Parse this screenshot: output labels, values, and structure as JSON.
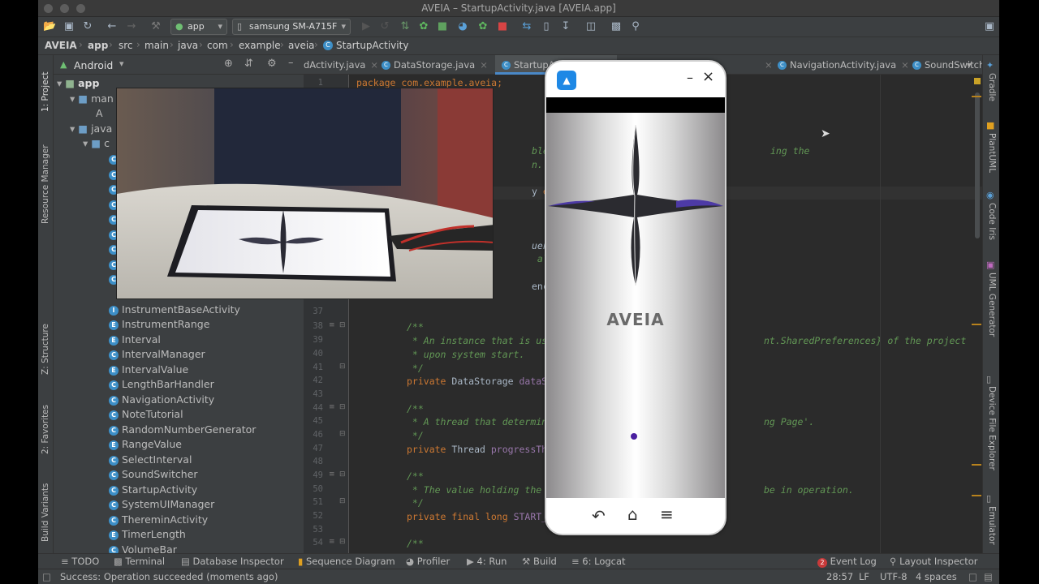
{
  "window": {
    "title": "AVEIA – StartupActivity.java [AVEIA.app]"
  },
  "toolbar": {
    "module_combo": "app",
    "device_combo": "samsung SM-A715F"
  },
  "breadcrumb": [
    "AVEIA",
    "app",
    "src",
    "main",
    "java",
    "com",
    "example",
    "aveia",
    "StartupActivity"
  ],
  "project_panel": {
    "view_mode": "Android",
    "tree_top": [
      {
        "label": "app"
      },
      {
        "label": "man"
      },
      {
        "label": "A"
      },
      {
        "label": "java"
      },
      {
        "label": "c"
      }
    ],
    "classes": [
      "InstrumentBaseActivity",
      "InstrumentRange",
      "Interval",
      "IntervalManager",
      "IntervalValue",
      "LengthBarHandler",
      "NavigationActivity",
      "NoteTutorial",
      "RandomNumberGenerator",
      "RangeValue",
      "SelectInterval",
      "SoundSwitcher",
      "StartupActivity",
      "SystemUIManager",
      "ThereminActivity",
      "TimerLength",
      "VolumeBar"
    ]
  },
  "left_tool_tabs": [
    "1: Project",
    "Resource Manager",
    "Z: Structure",
    "2: Favorites",
    "Build Variants"
  ],
  "right_tool_tabs": [
    "Gradle",
    "PlantUML",
    "Code Iris",
    "UML Generator",
    "Device File Explorer",
    "Emulator"
  ],
  "editor_tabs": [
    {
      "label": "dActivity.java",
      "active": false
    },
    {
      "label": "DataStorage.java",
      "active": false
    },
    {
      "label": "StartupAct",
      "active": true
    },
    {
      "label": "NavigationActivity.java",
      "active": false
    },
    {
      "label": "SoundSwitcher.ja",
      "active": false
    }
  ],
  "code": {
    "line_numbers": [
      "1",
      "",
      "",
      "",
      "",
      "",
      "",
      "",
      "",
      "",
      "",
      "",
      "",
      "",
      "",
      "",
      "37",
      "38",
      "39",
      "40",
      "41",
      "42",
      "43",
      "44",
      "45",
      "46",
      "47",
      "48",
      "49",
      "50",
      "51",
      "52",
      "53",
      "54"
    ],
    "package_line": "package com.example.aveia;",
    "frag_1": "ble for the",
    "frag_1b": "ing the",
    "frag_2": "n.",
    "frag_3a": "y ",
    "frag_3b": "extends",
    "frag_4": "uencyManag",
    "frag_5": " all frequ",
    "frag_6": "encyManage",
    "l38": "/**",
    "l39a": " * An instance that is used for",
    "l39b": "nt.SharedPreferences} of the project",
    "l40": " * upon system start.",
    "l41": " */",
    "l42a": "private ",
    "l42b": "DataStorage ",
    "l42c": "dataStorage",
    "l42d": ";",
    "l44": "/**",
    "l45a": " * A thread that determines the",
    "l45b": "ng Page'.",
    "l46": " */",
    "l47a": "private ",
    "l47b": "Thread ",
    "l47c": "progressThread",
    "l47d": ";",
    "l49": "/**",
    "l50a": " * The value holding the length",
    "l50b": "be in operation.",
    "l51": " */",
    "l52a": "private final long ",
    "l52b": "START_ACTIVIT",
    "l54": "/**"
  },
  "phone": {
    "app_name": "AVEIA",
    "brand_text": "AVEIA",
    "minimize_glyph": "–",
    "close_glyph": "×"
  },
  "bottom_tools": {
    "todo": "TODO",
    "terminal": "Terminal",
    "database_inspector": "Database Inspector",
    "sequence_diagram": "Sequence Diagram",
    "profiler": "Profiler",
    "run": "4: Run",
    "build": "Build",
    "logcat": "6: Logcat",
    "event_log": "Event Log",
    "event_log_count": "2",
    "layout_inspector": "Layout Inspector"
  },
  "status": {
    "message": "Success: Operation succeeded (moments ago)",
    "position": "28:57",
    "line_sep": "LF",
    "encoding": "UTF-8",
    "indent": "4 spaces"
  },
  "colors": {
    "ide_bg": "#2b2b2b",
    "panel_bg": "#3c3f41",
    "keyword": "#cc7832",
    "comment": "#629755",
    "field": "#9876aa",
    "accent": "#4a88c7"
  }
}
